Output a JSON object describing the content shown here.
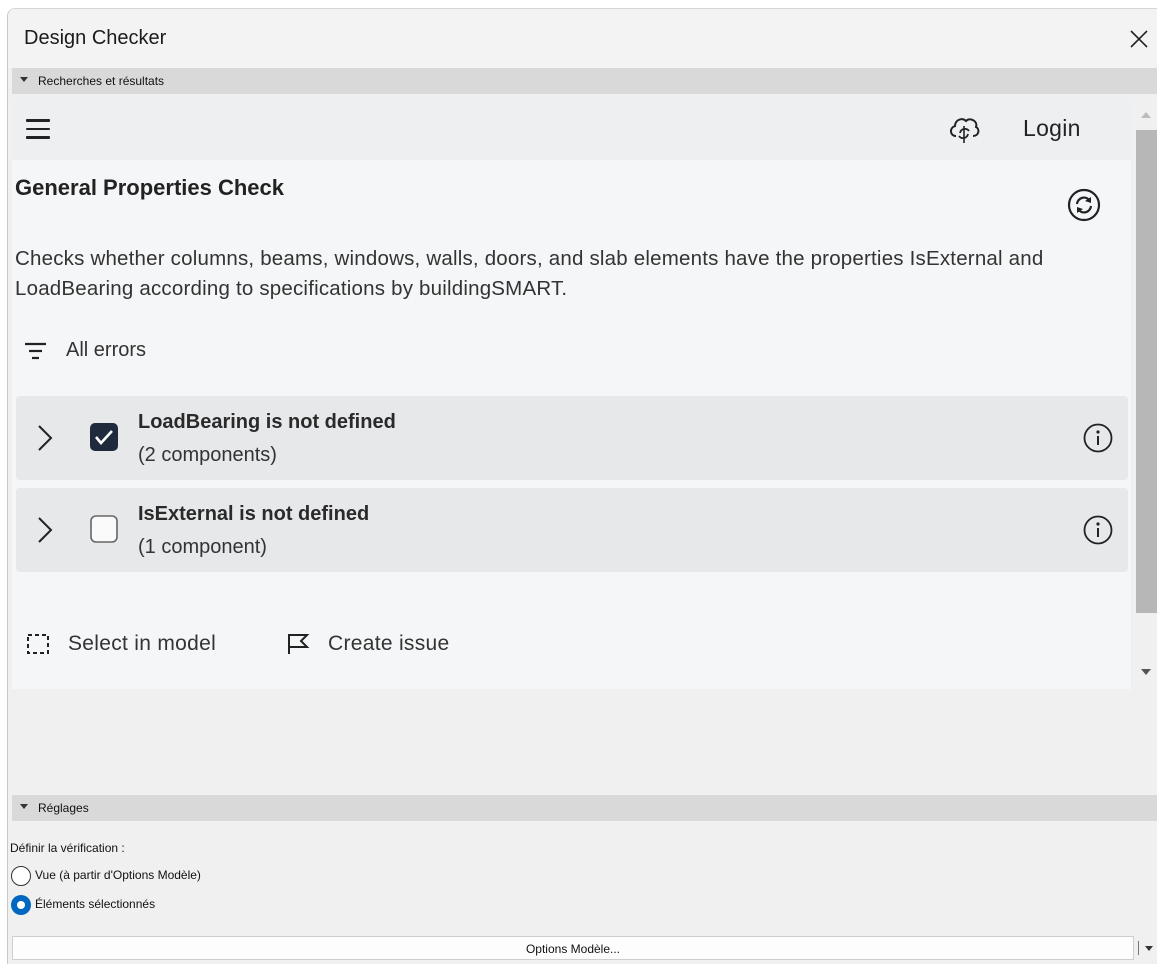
{
  "window": {
    "title": "Design Checker"
  },
  "sections": {
    "results_label": "Recherches et résultats",
    "settings_label": "Réglages"
  },
  "panel": {
    "login_label": "Login",
    "check_title": "General Properties Check",
    "description": "Checks whether columns, beams, windows, walls, doors, and slab elements have the properties IsExternal and LoadBearing according to specifications by buildingSMART.",
    "filter_label": "All errors",
    "errors": [
      {
        "title": "LoadBearing is not defined",
        "count": "(2 components)",
        "checked": true
      },
      {
        "title": "IsExternal is not defined",
        "count": "(1 component)",
        "checked": false
      }
    ],
    "actions": {
      "select_label": "Select in model",
      "issue_label": "Create issue"
    }
  },
  "settings": {
    "define_label": "Définir la vérification :",
    "options": [
      {
        "label": "Vue (à partir d'Options Modèle)",
        "selected": false
      },
      {
        "label": "Éléments sélectionnés",
        "selected": true
      }
    ],
    "model_options_button": "Options Modèle..."
  },
  "colors": {
    "accent": "#0067c0",
    "checkbox_checked": "#1f2a3d",
    "section_header": "#d9d9d9"
  },
  "icons": [
    "close-icon",
    "hamburger-menu-icon",
    "cloud-sync-icon",
    "refresh-icon",
    "filter-icon",
    "chevron-right-icon",
    "checkbox-icon",
    "info-icon",
    "select-box-icon",
    "flag-icon"
  ]
}
